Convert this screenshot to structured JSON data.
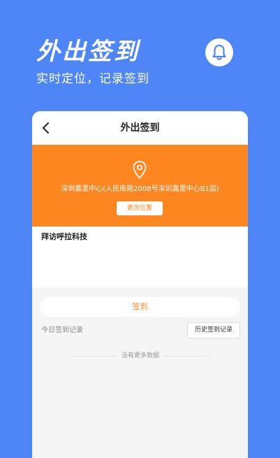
{
  "hero": {
    "title": "外出签到",
    "subtitle": "实时定位，记录签到"
  },
  "icons": {
    "notification": "bell-icon",
    "back": "chevron-left-icon",
    "location": "map-pin-icon"
  },
  "colors": {
    "background": "#4f86f7",
    "accent_orange": "#fd8621",
    "card_background": "#f5f5f5"
  },
  "navbar": {
    "title": "外出签到"
  },
  "location": {
    "address": "深圳嘉里中心(人民南路2008号深圳嘉里中心B1层)",
    "change_label": "更改位置"
  },
  "visit": {
    "text": "拜访呼拉科技"
  },
  "checkin": {
    "button_label": "签到"
  },
  "records": {
    "today_label": "今日签到记录",
    "history_label": "历史签到记录",
    "empty_text": "没有更多数据"
  }
}
